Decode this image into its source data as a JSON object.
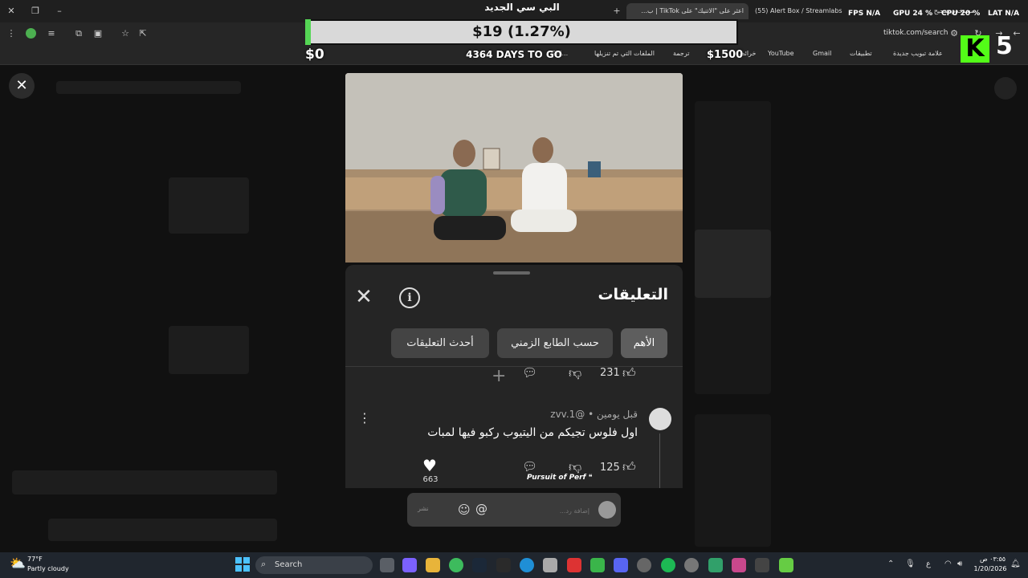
{
  "browser": {
    "tabs": [
      {
        "title": "مستخدم صحيح",
        "active": false
      },
      {
        "title": "(55) Alert Box / Streamlabs",
        "active": false
      },
      {
        "title": "اعثر على \"الاتنيك\" على TikTok | ب...",
        "active": true
      }
    ],
    "address": "tiktok.com/search",
    "bookmarks": [
      "علامة تبويب جديدة",
      "تطبيقات",
      "Gmail",
      "YouTube",
      "خرائط",
      "ترجمة",
      "الملفات التي تم تنزيلها",
      "Ghi..."
    ],
    "stats": {
      "fps": "FPS N/A",
      "gpu": "GPU 24 %",
      "cpu": "CPU 20 %",
      "lat": "LAT N/A"
    }
  },
  "stream_overlay": {
    "title": "البي سي الجديد",
    "goal_text": "$19 (1.27%)",
    "goal_progress_percent": 1.27,
    "goal_start": "$0",
    "goal_end": "$1500",
    "days_left": "4364 DAYS TO GO",
    "kick_number": "5",
    "colors": {
      "goal_fill": "#55d655",
      "kick": "#53fc18"
    }
  },
  "comments": {
    "title": "التعليقات",
    "sort_options": [
      {
        "label": "الأهم",
        "selected": true
      },
      {
        "label": "حسب الطابع الزمني",
        "selected": false
      },
      {
        "label": "أحدث التعليقات",
        "selected": false
      }
    ],
    "prev_comment": {
      "likes": "231"
    },
    "comment": {
      "user": "@zvv.1",
      "time": "قبل يومين",
      "text": "اول فلوس تجيكم من اليتيوب ركبو فيها لمبات",
      "likes": "125"
    },
    "video_likes": "663",
    "watermark": "Pursuit of Perf",
    "input_placeholder": "إضافة رد...",
    "post_label": "نشر"
  },
  "taskbar": {
    "weather_temp": "77°F",
    "weather_desc": "Partly cloudy",
    "search_label": "Search",
    "time": "٠٣:٥٥ ص",
    "date": "1/20/2026",
    "lang": "ع"
  }
}
